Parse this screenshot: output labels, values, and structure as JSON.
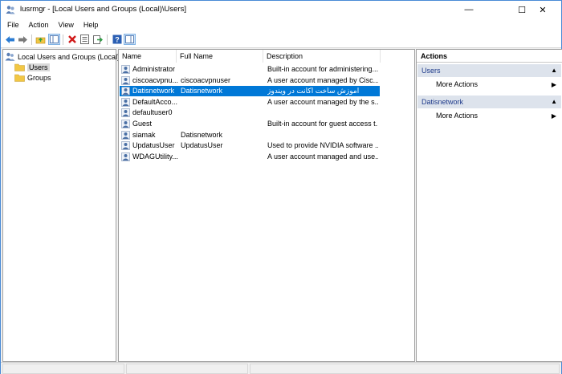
{
  "window": {
    "title": "lusrmgr - [Local Users and Groups (Local)\\Users]",
    "controls": {
      "minimize": "—",
      "maximize": "☐",
      "close": "✕"
    }
  },
  "menu": [
    "File",
    "Action",
    "View",
    "Help"
  ],
  "toolbar": {
    "icons": [
      "back-arrow-icon",
      "forward-arrow-icon",
      "up-folder-icon",
      "show-hide-tree-icon",
      "delete-icon",
      "properties-icon",
      "export-list-icon",
      "help-icon",
      "show-hide-action-pane-icon"
    ]
  },
  "tree": {
    "root": "Local Users and Groups (Local)",
    "children": [
      "Users",
      "Groups"
    ],
    "selected": "Users"
  },
  "list": {
    "columns": [
      "Name",
      "Full Name",
      "Description"
    ],
    "rows": [
      {
        "name": "Administrator",
        "full": "",
        "desc": "Built-in account for administering..."
      },
      {
        "name": "ciscoacvpnu...",
        "full": "ciscoacvpnuser",
        "desc": "A user account managed by Cisc..."
      },
      {
        "name": "Datisnetwork",
        "full": "Datisnetwork",
        "desc": "اموزش ساخت اکانت در ویندوز",
        "selected": true
      },
      {
        "name": "DefaultAcco...",
        "full": "",
        "desc": "A user account managed by the s..."
      },
      {
        "name": "defaultuser0",
        "full": "",
        "desc": ""
      },
      {
        "name": "Guest",
        "full": "",
        "desc": "Built-in account for guest access t..."
      },
      {
        "name": "siamak",
        "full": "Datisnetwork",
        "desc": ""
      },
      {
        "name": "UpdatusUser",
        "full": "UpdatusUser",
        "desc": "Used to provide NVIDIA software ..."
      },
      {
        "name": "WDAGUtility...",
        "full": "",
        "desc": "A user account managed and use..."
      }
    ]
  },
  "actions": {
    "header": "Actions",
    "sections": [
      {
        "title": "Users",
        "items": [
          "More Actions"
        ]
      },
      {
        "title": "Datisnetwork",
        "items": [
          "More Actions"
        ]
      }
    ],
    "collapse_glyph": "▲",
    "submenu_glyph": "▶"
  },
  "colors": {
    "selection": "#0078d7",
    "section_bg": "#dde3ec",
    "section_text": "#1e3a8a",
    "folder": "#f2c744",
    "window_border": "#4a8bd6"
  }
}
